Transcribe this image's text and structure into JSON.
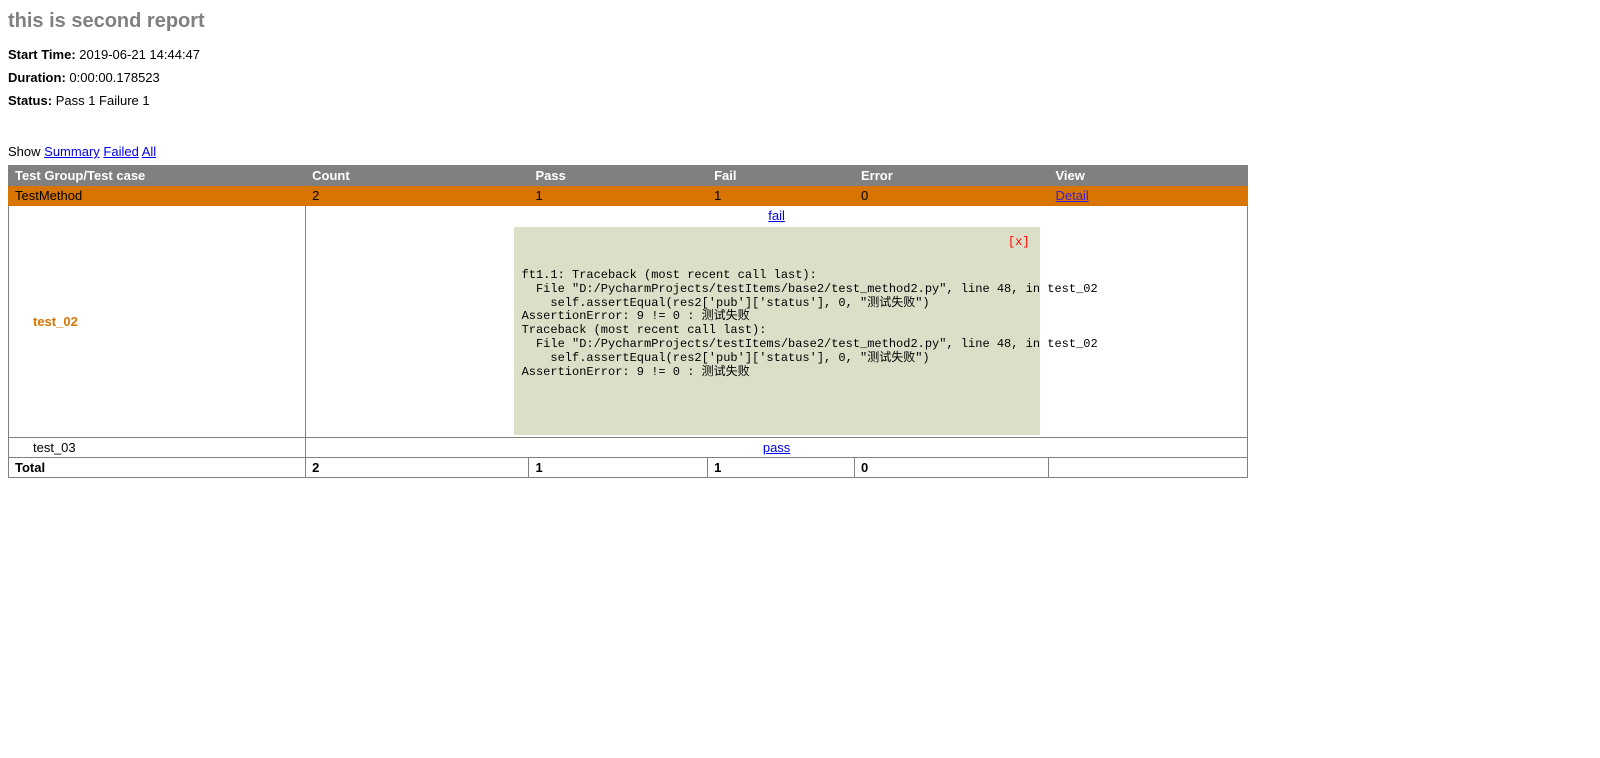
{
  "title": "this is second report",
  "meta": {
    "start_label": "Start Time:",
    "start_value": "2019-06-21 14:44:47",
    "duration_label": "Duration:",
    "duration_value": "0:00:00.178523",
    "status_label": "Status:",
    "status_value": "Pass 1 Failure 1"
  },
  "filter": {
    "show_label": "Show",
    "summary": "Summary",
    "failed": "Failed",
    "all": "All"
  },
  "headers": {
    "name": "Test Group/Test case",
    "count": "Count",
    "pass": "Pass",
    "fail": "Fail",
    "error": "Error",
    "view": "View"
  },
  "group": {
    "name": "TestMethod",
    "count": "2",
    "pass": "1",
    "fail": "1",
    "error": "0",
    "detail": "Detail"
  },
  "row_fail": {
    "name": "test_02",
    "status": "fail",
    "close": "[x]",
    "trace": "ft1.1: Traceback (most recent call last):\n  File \"D:/PycharmProjects/testItems/base2/test_method2.py\", line 48, in test_02\n    self.assertEqual(res2['pub']['status'], 0, \"测试失败\")\nAssertionError: 9 != 0 : 测试失败\nTraceback (most recent call last):\n  File \"D:/PycharmProjects/testItems/base2/test_method2.py\", line 48, in test_02\n    self.assertEqual(res2['pub']['status'], 0, \"测试失败\")\nAssertionError: 9 != 0 : 测试失败"
  },
  "row_pass": {
    "name": "test_03",
    "status": "pass"
  },
  "total": {
    "label": "Total",
    "count": "2",
    "pass": "1",
    "fail": "1",
    "error": "0"
  }
}
